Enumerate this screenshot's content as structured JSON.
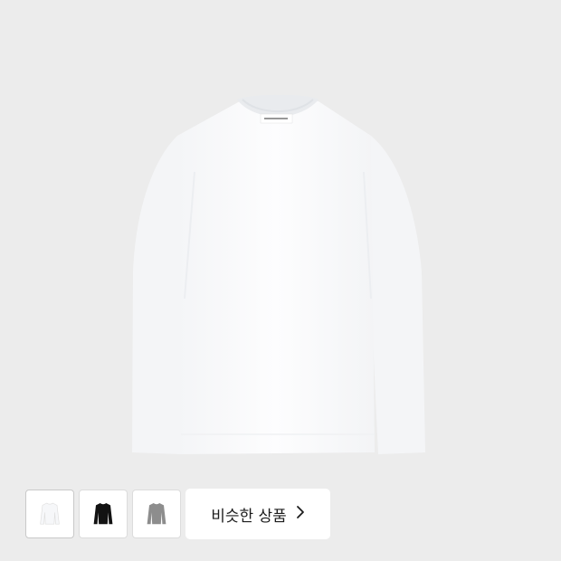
{
  "product": {
    "image_icon": "long-sleeve-tshirt-white",
    "neck_label_text": "",
    "background_color": "#ececec",
    "shirt_color": "#fbfcfd"
  },
  "thumbnails": [
    {
      "color_name": "white",
      "icon": "tshirt-white-icon",
      "color": "#f6f7f9"
    },
    {
      "color_name": "black",
      "icon": "tshirt-black-icon",
      "color": "#121212"
    },
    {
      "color_name": "gray",
      "icon": "tshirt-gray-icon",
      "color": "#8d8d8d"
    }
  ],
  "similar_products": {
    "label": "비슷한 상품",
    "icon": "chevron-right-icon"
  }
}
